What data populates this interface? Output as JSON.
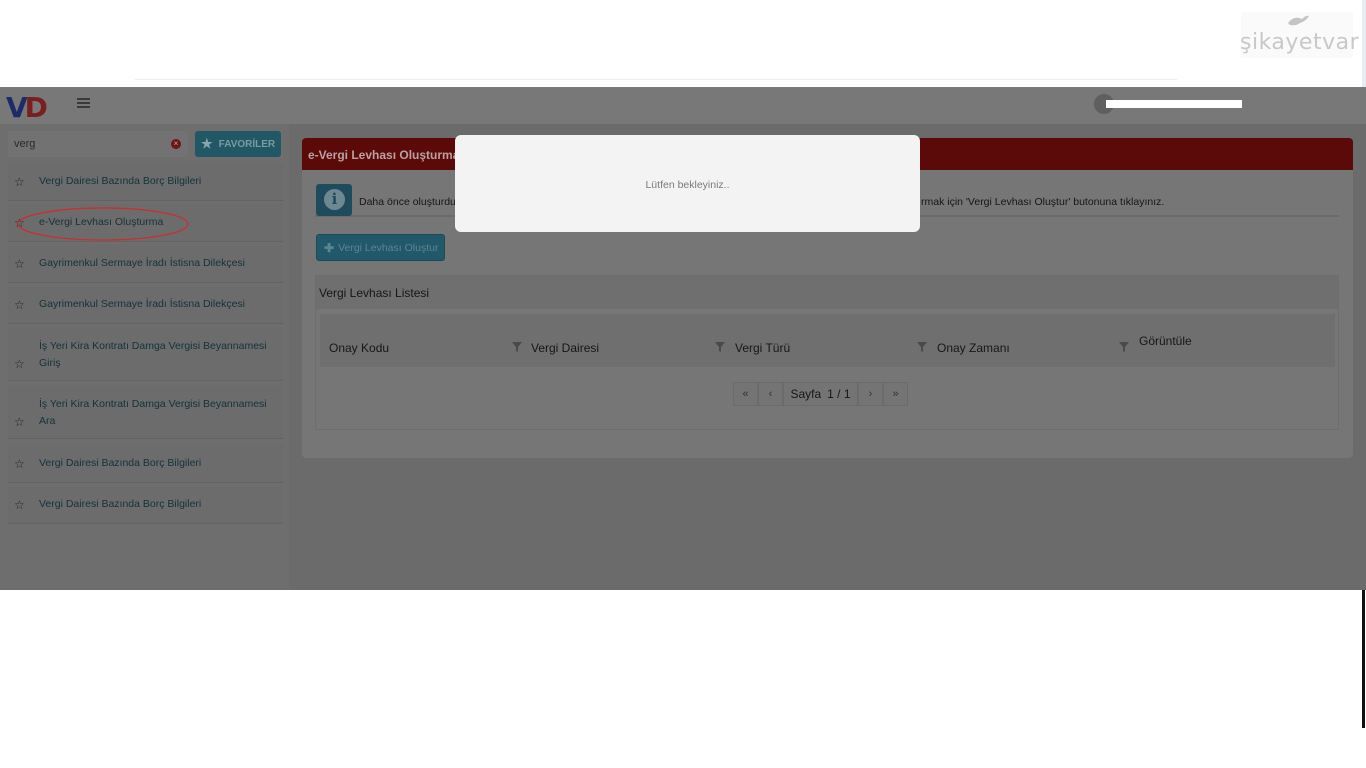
{
  "branding": {
    "site_logo_text": "şikayetvar",
    "app_logo": "VD"
  },
  "colors": {
    "panel_header": "#5c0909",
    "accent_teal": "#21596b",
    "modal_bg": "#f3f3f3",
    "annotation_red": "#d12a2a"
  },
  "sidebar": {
    "search_value": "verg",
    "favorites_label": "FAVORİLER",
    "items": [
      {
        "label": "Vergi Dairesi Bazında Borç Bilgileri"
      },
      {
        "label": "e-Vergi Levhası Oluşturma"
      },
      {
        "label": "Gayrimenkul Sermaye İradı İstisna Dilekçesi"
      },
      {
        "label": "Gayrimenkul Sermaye İradı İstisna Dilekçesi"
      },
      {
        "label": "İş Yeri Kira Kontratı Damga Vergisi Beyannamesi Giriş"
      },
      {
        "label": "İş Yeri Kira Kontratı Damga Vergisi Beyannamesi Ara"
      },
      {
        "label": "Vergi Dairesi Bazında Borç Bilgileri"
      },
      {
        "label": "Vergi Dairesi Bazında Borç Bilgileri"
      }
    ]
  },
  "panel": {
    "title": "e-Vergi Levhası Oluşturma",
    "info_left": "Daha önce oluşturdu",
    "info_right": "rmak için 'Vergi Levhası Oluştur' butonuna tıklayınız.",
    "create_button": "Vergi Levhası Oluştur",
    "list_title": "Vergi Levhası Listesi",
    "columns": [
      "Onay Kodu",
      "Vergi Dairesi",
      "Vergi Türü",
      "Onay Zamanı",
      "Görüntüle"
    ],
    "pager": {
      "first": "«",
      "prev": "‹",
      "page_label": "Sayfa",
      "page_value": "1 / 1",
      "next": "›",
      "last": "»"
    }
  },
  "modal": {
    "text": "Lütfen bekleyiniz.."
  }
}
